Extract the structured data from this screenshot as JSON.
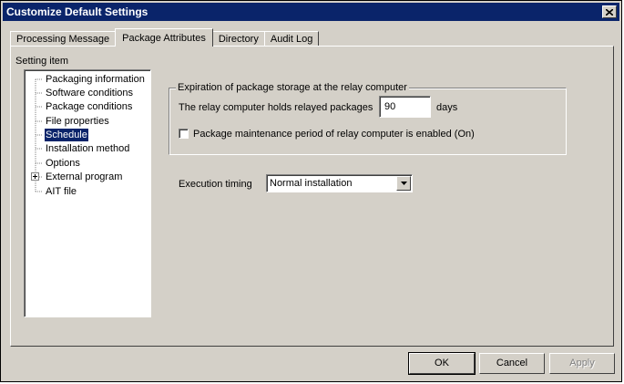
{
  "window": {
    "title": "Customize Default Settings"
  },
  "tabs": [
    {
      "label": "Processing Message",
      "active": false
    },
    {
      "label": "Package Attributes",
      "active": true
    },
    {
      "label": "Directory",
      "active": false
    },
    {
      "label": "Audit Log",
      "active": false
    }
  ],
  "setting_item": {
    "label": "Setting item",
    "items": [
      {
        "label": "Packaging information"
      },
      {
        "label": "Software conditions"
      },
      {
        "label": "Package conditions"
      },
      {
        "label": "File properties"
      },
      {
        "label": "Schedule",
        "selected": true
      },
      {
        "label": "Installation method"
      },
      {
        "label": "Options"
      },
      {
        "label": "External program",
        "expandable": true
      },
      {
        "label": "AIT file"
      }
    ]
  },
  "expiration": {
    "legend": "Expiration of package storage at the relay computer",
    "holds_label": "The relay computer holds relayed packages",
    "days_value": "90",
    "days_unit": "days",
    "maintenance_label": "Package maintenance period of relay computer is enabled (On)",
    "maintenance_checked": false
  },
  "execution": {
    "label": "Execution timing",
    "selected": "Normal installation"
  },
  "buttons": {
    "ok": "OK",
    "cancel": "Cancel",
    "apply": "Apply"
  }
}
